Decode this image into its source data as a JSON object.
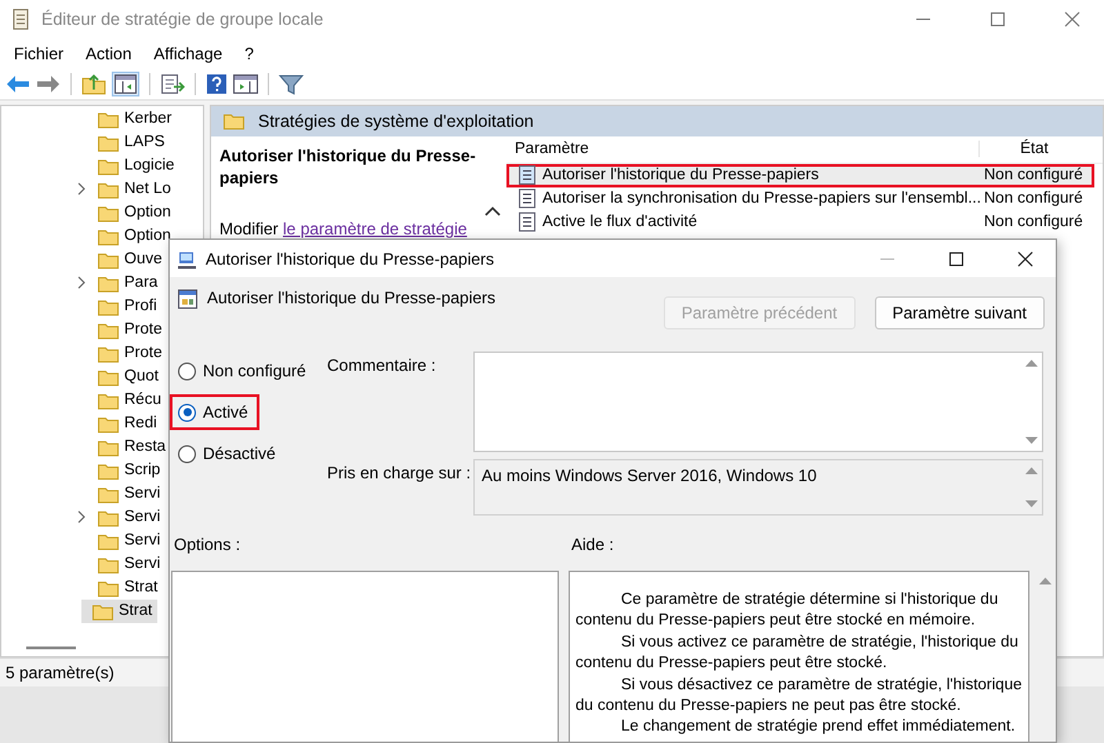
{
  "window": {
    "title": "Éditeur de stratégie de groupe locale"
  },
  "menu": [
    "Fichier",
    "Action",
    "Affichage",
    "?"
  ],
  "tree": {
    "items": [
      {
        "label": "Kerber",
        "expandable": false,
        "selected": false
      },
      {
        "label": "LAPS",
        "expandable": false,
        "selected": false
      },
      {
        "label": "Logicie",
        "expandable": false,
        "selected": false
      },
      {
        "label": "Net Lo",
        "expandable": true,
        "selected": false
      },
      {
        "label": "Option",
        "expandable": false,
        "selected": false
      },
      {
        "label": "Option",
        "expandable": false,
        "selected": false
      },
      {
        "label": "Ouve",
        "expandable": false,
        "selected": false
      },
      {
        "label": "Para",
        "expandable": true,
        "selected": false
      },
      {
        "label": "Profi",
        "expandable": false,
        "selected": false
      },
      {
        "label": "Prote",
        "expandable": false,
        "selected": false
      },
      {
        "label": "Prote",
        "expandable": false,
        "selected": false
      },
      {
        "label": "Quot",
        "expandable": false,
        "selected": false
      },
      {
        "label": "Récu",
        "expandable": false,
        "selected": false
      },
      {
        "label": "Redi",
        "expandable": false,
        "selected": false
      },
      {
        "label": "Resta",
        "expandable": false,
        "selected": false
      },
      {
        "label": "Scrip",
        "expandable": false,
        "selected": false
      },
      {
        "label": "Servi",
        "expandable": false,
        "selected": false
      },
      {
        "label": "Servi",
        "expandable": true,
        "selected": false
      },
      {
        "label": "Servi",
        "expandable": false,
        "selected": false
      },
      {
        "label": "Servi",
        "expandable": false,
        "selected": false
      },
      {
        "label": "Strat",
        "expandable": false,
        "selected": false
      },
      {
        "label": "Strat",
        "expandable": false,
        "selected": true
      }
    ]
  },
  "details": {
    "header": "Stratégies de système d'exploitation",
    "policy_title": "Autoriser l'historique du Presse-papiers",
    "edit_prefix": "Modifier",
    "edit_link": "le paramètre de stratégie",
    "columns": [
      "Paramètre",
      "État"
    ],
    "rows": [
      {
        "name": "Autoriser l'historique du Presse-papiers",
        "state": "Non configuré",
        "selected": true,
        "highlighted": true
      },
      {
        "name": "Autoriser la synchronisation du Presse-papiers sur l'ensembl...",
        "state": "Non configuré",
        "selected": false,
        "highlighted": false
      },
      {
        "name": "Active le flux d'activité",
        "state": "Non configuré",
        "selected": false,
        "highlighted": false
      }
    ]
  },
  "status_bar": "5 paramètre(s)",
  "dialog": {
    "title": "Autoriser l'historique du Presse-papiers",
    "heading": "Autoriser l'historique du Presse-papiers",
    "buttons": [
      {
        "label": "Paramètre précédent",
        "disabled": true
      },
      {
        "label": "Paramètre suivant",
        "disabled": false
      }
    ],
    "options": [
      {
        "label": "Non configuré",
        "selected": false,
        "outlined": false
      },
      {
        "label": "Activé",
        "selected": true,
        "outlined": true
      },
      {
        "label": "Désactivé",
        "selected": false,
        "outlined": false
      }
    ],
    "comment_label": "Commentaire :",
    "supported_label": "Pris en charge sur :",
    "supported_value": "Au moins Windows Server 2016, Windows 10",
    "options_label": "Options :",
    "help_label": "Aide :",
    "help_paragraphs": [
      "Ce paramètre de stratégie détermine si l'historique du contenu du Presse-papiers peut être stocké en mémoire.",
      "Si vous activez ce paramètre de stratégie, l'historique du contenu du Presse-papiers peut être stocké.",
      "Si vous désactivez ce paramètre de stratégie, l'historique du contenu du Presse-papiers ne peut pas être stocké.",
      "Le changement de stratégie prend effet immédiatement."
    ]
  }
}
